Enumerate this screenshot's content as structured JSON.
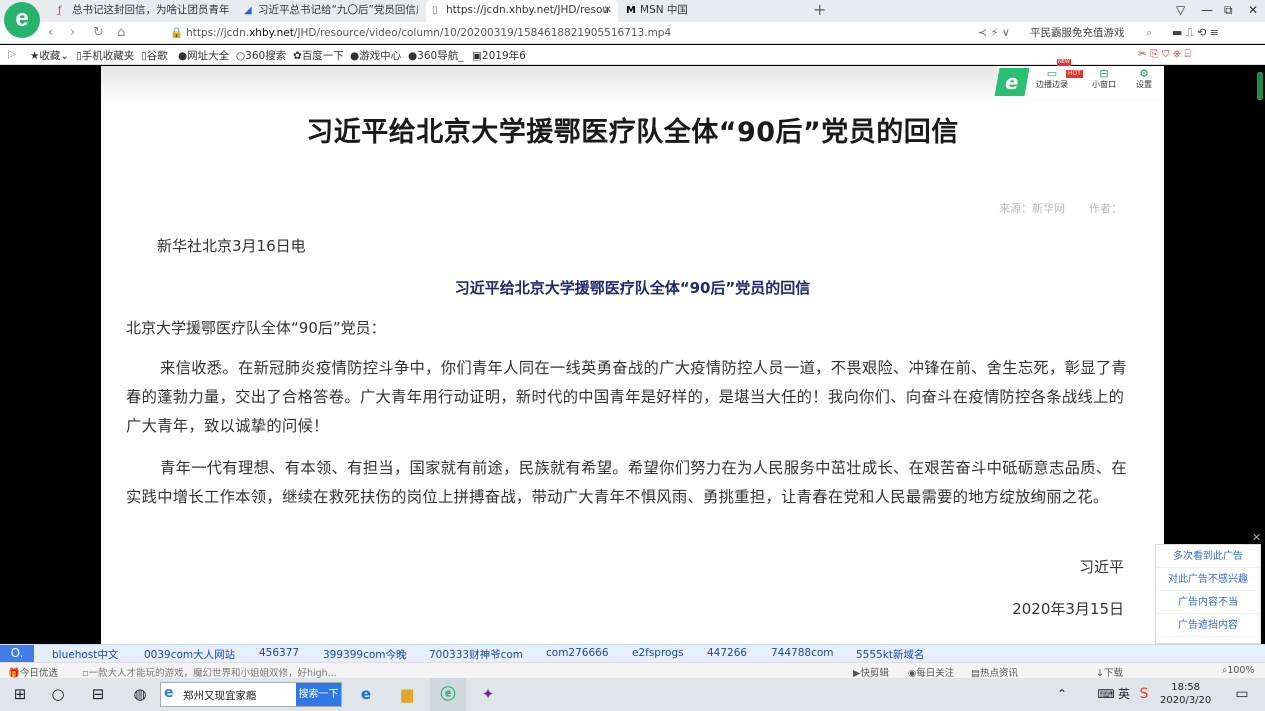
{
  "browser": {
    "logo": "e",
    "tabs": [
      {
        "icon": "ƒ",
        "label": "总书记这封回信，为啥让团员青年"
      },
      {
        "icon": "◢",
        "label": "习近平总书记给“九〇后”党员回信后"
      },
      {
        "icon": "▯",
        "label": "https://jcdn.xhby.net/JHD/resou"
      },
      {
        "icon": "M",
        "label": "MSN 中国"
      }
    ],
    "new_tab": "+",
    "window_controls": {
      "menu": "▽",
      "minimize": "—",
      "restore": "⧉",
      "close": "✕"
    },
    "url_domain_prefix": "https://jcdn.",
    "url_domain": "xhby.net",
    "url_path": "/JHD/resource/video/column/10/20200319/1584618821905516713.mp4",
    "search_text": "平民霸服免充值游戏",
    "bookmarks": [
      "收藏",
      "手机收藏夹",
      "谷歌",
      "网址大全",
      "360搜索",
      "百度一下",
      "游戏中心",
      "360导航_",
      "2019年6"
    ]
  },
  "overlay": {
    "items": [
      "边播边录",
      "小窗口",
      "设置"
    ],
    "hot": "HOT",
    "new": "NEW"
  },
  "article": {
    "title": "习近平给北京大学援鄂医疗队全体“90后”党员的回信",
    "source": "来源：新华网",
    "author": "作者：",
    "dateline": "新华社北京3月16日电",
    "subtitle": "习近平给北京大学援鄂医疗队全体“90后”党员的回信",
    "salutation": "北京大学援鄂医疗队全体“90后”党员：",
    "paragraphs": [
      "来信收悉。在新冠肺炎疫情防控斗争中，你们青年人同在一线英勇奋战的广大疫情防控人员一道，不畏艰险、冲锋在前、舍生忘死，彰显了青春的蓬勃力量，交出了合格答卷。广大青年用行动证明，新时代的中国青年是好样的，是堪当大任的！我向你们、向奋斗在疫情防控各条战线上的广大青年，致以诚挚的问候！",
      "青年一代有理想、有本领、有担当，国家就有前途，民族就有希望。希望你们努力在为人民服务中茁壮成长、在艰苦奋斗中砥砺意志品质、在实践中增长工作本领，继续在救死扶伤的岗位上拼搏奋战，带动广大青年不惧风雨、勇挑重担，让青春在党和人民最需要的地方绽放绚丽之花。"
    ],
    "signer": "习近平",
    "date": "2020年3月15日"
  },
  "ad_panel": {
    "close": "✕",
    "items": [
      "多次看到此广告",
      "对此广告不感兴趣",
      "广告内容不当",
      "广告遮挡内容"
    ]
  },
  "link_bar": {
    "first": "O.",
    "links": [
      "bluehost中文",
      "0039com大人网站",
      "456377",
      "399399com今晚",
      "700333财神爷com",
      "com276666",
      "e2fsprogs",
      "447266",
      "744788com",
      "5555kt新域名"
    ]
  },
  "status_bar": {
    "left": "今日优选",
    "ticker": "一款大人才能玩的游戏，魔幻世界和小姐姐双修，好high...",
    "right": [
      "快剪辑",
      "每日关注",
      "热点资讯",
      "下载"
    ],
    "zoom": "100%"
  },
  "taskbar": {
    "search_text": "郑州又现宜家瘾",
    "search_button": "搜索一下",
    "ime": "英",
    "time": "18:58",
    "date": "2020/3/20"
  }
}
